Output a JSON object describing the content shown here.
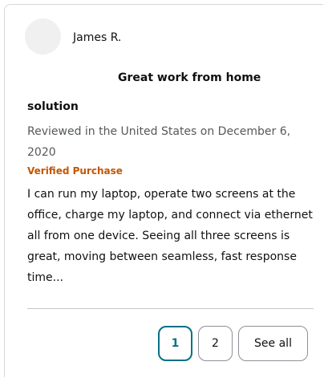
{
  "review": {
    "reviewer_name": "James R.",
    "title_line1": "Great work from home",
    "title_line2": "solution",
    "meta": "Reviewed in the United States on December 6, 2020",
    "verified": "Verified Purchase",
    "body": "I can run my laptop, operate two screens at the office, charge my laptop, and connect via ethernet all from one device. Seeing all three screens is great, moving between seamless, fast response time..."
  },
  "pagination": {
    "page1": "1",
    "page2": "2",
    "see_all": "See all",
    "current_page": 1
  },
  "colors": {
    "verified": "#c45500",
    "active_page": "#007185",
    "meta_text": "#565959"
  }
}
